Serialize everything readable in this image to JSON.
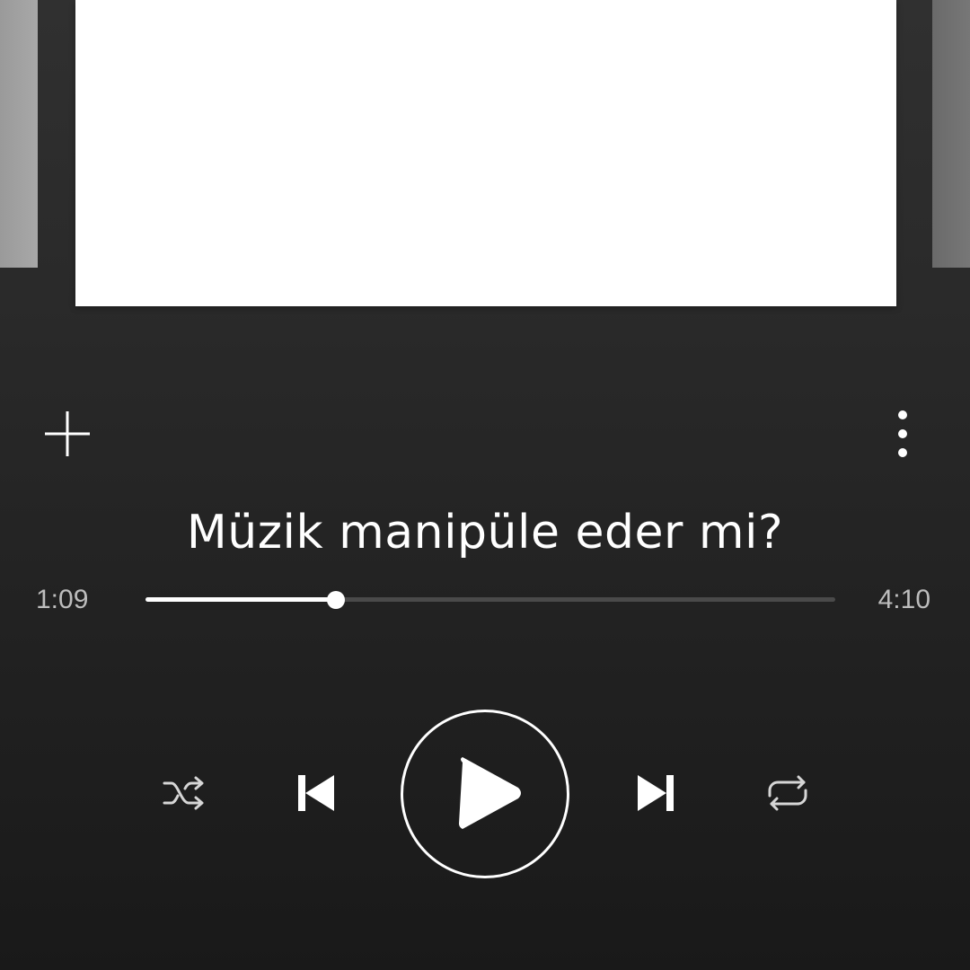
{
  "album_art": {
    "background": "#ffffff"
  },
  "track": {
    "title": "Müzik manipüle eder mi?"
  },
  "playback": {
    "elapsed": "1:09",
    "total": "4:10",
    "progress_fraction": 0.276
  },
  "icons": {
    "add": "plus-icon",
    "more": "more-vertical-icon",
    "shuffle": "shuffle-icon",
    "previous": "skip-previous-icon",
    "play": "play-icon",
    "next": "skip-next-icon",
    "repeat": "repeat-icon"
  },
  "colors": {
    "background_top": "#303030",
    "background_bottom": "#191919",
    "foreground": "#ffffff",
    "muted_text": "#bdbdbd",
    "progress_track": "#4a4a4a"
  }
}
